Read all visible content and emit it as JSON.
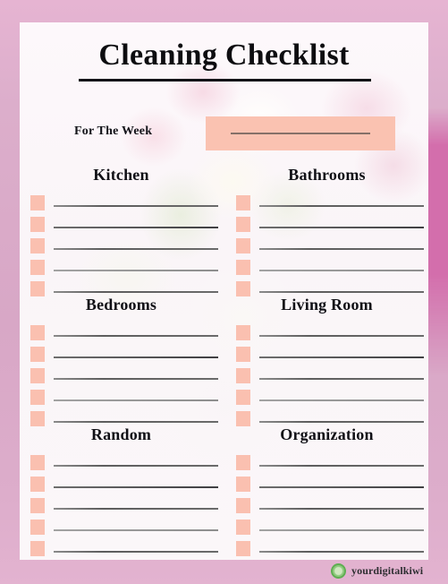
{
  "page": {
    "title": "Cleaning Checklist",
    "week_label": "For The Week",
    "week_value": ""
  },
  "colors": {
    "frame_pink": "#dcaecb",
    "paper": "#fbf6f9",
    "checkbox_salmon": "#fac0b0",
    "week_box_peach": "#fac2b1",
    "rule_dark": "#131317",
    "writeline_gray": "#6b6b6b",
    "logo_green": "#5fae52"
  },
  "sections": [
    {
      "title": "Kitchen",
      "rows": 5
    },
    {
      "title": "Bathrooms",
      "rows": 5
    },
    {
      "title": "Bedrooms",
      "rows": 5
    },
    {
      "title": "Living Room",
      "rows": 5
    },
    {
      "title": "Random",
      "rows": 5
    },
    {
      "title": "Organization",
      "rows": 5
    }
  ],
  "footer": {
    "watermark_text": "yourdigitalkiwi",
    "logo_icon": "kiwi-circle-icon"
  }
}
